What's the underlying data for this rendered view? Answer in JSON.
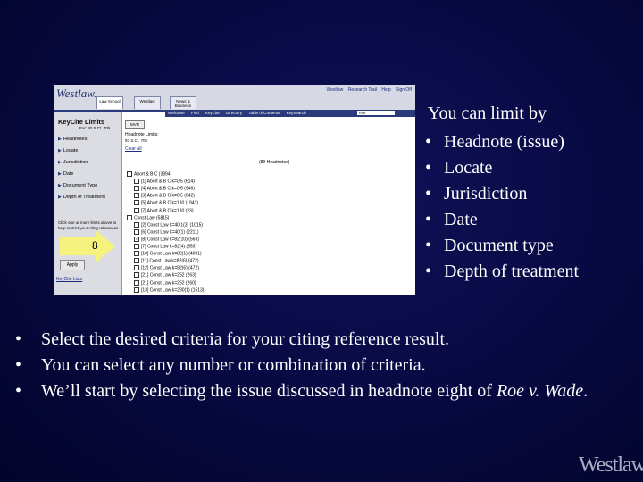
{
  "screenshot": {
    "logo": "Westlaw.",
    "tabs": [
      {
        "label": "Law School",
        "active": true
      },
      {
        "label": "Westlaw",
        "active": false
      },
      {
        "label": "News & Business",
        "active": false
      }
    ],
    "top_links": [
      "Westlaw",
      "Research Trail",
      "Help",
      "Sign Off"
    ],
    "nav_links": [
      "Welcome",
      "Find",
      "KeyCite",
      "Directory",
      "Table of Contents",
      "KeySearch"
    ],
    "search_value": "Roe",
    "sidebar": {
      "title": "KeyCite Limits",
      "citation": "For: 93 S.Ct. 705",
      "items": [
        "Headnotes",
        "Locate",
        "Jurisdiction",
        "Date",
        "Document Type",
        "Depth of Treatment"
      ],
      "note": "Click one or more limits above to help restrict your citing references.",
      "apply_label": "Apply",
      "keycite_link": "KeyCite Lists"
    },
    "main": {
      "mvr_label": "MVR",
      "headnote_title": "Headnote Limits:",
      "headnote_cite": "93 S.Ct. 705",
      "clear_label": "Clear All",
      "count": "(89 Headnotes)",
      "rows": [
        {
          "text": "Abort & B C (3894)",
          "checked": false,
          "indent": 0
        },
        {
          "text": "[1] Abort & B C k=0.5 (614)",
          "checked": false,
          "indent": 1
        },
        {
          "text": "[4] Abort & B C k=0.5 (946)",
          "checked": false,
          "indent": 1
        },
        {
          "text": "[3] Abort & B C k=0.5 (642)",
          "checked": false,
          "indent": 1
        },
        {
          "text": "[5] Abort & B C k=130 (1941)",
          "checked": false,
          "indent": 1
        },
        {
          "text": "[7] Abort & B C k=130 (23)",
          "checked": false,
          "indent": 1
        },
        {
          "text": "Const Law (5815)",
          "checked": false,
          "indent": 0
        },
        {
          "text": "[2] Const Law k=40.1(3) (1015)",
          "checked": false,
          "indent": 1
        },
        {
          "text": "[6] Const Law k=40(1) (2211)",
          "checked": false,
          "indent": 1
        },
        {
          "text": "[8] Const Law k=82(10) (563)",
          "checked": true,
          "indent": 1
        },
        {
          "text": "[7] Const Law k=82(4) (553)",
          "checked": false,
          "indent": 1
        },
        {
          "text": "[10] Const Law k=82(1) (4001)",
          "checked": false,
          "indent": 1
        },
        {
          "text": "[11] Const Law k=82(6) (472)",
          "checked": false,
          "indent": 1
        },
        {
          "text": "[12] Const Law k=82(6) (472)",
          "checked": false,
          "indent": 1
        },
        {
          "text": "[21] Const Law k=252 (263)",
          "checked": false,
          "indent": 1
        },
        {
          "text": "[21] Const Law k=252 (260)",
          "checked": false,
          "indent": 1
        },
        {
          "text": "[13] Const Law k=230(1) (1513)",
          "checked": false,
          "indent": 1
        }
      ]
    },
    "callout": "8"
  },
  "slide": {
    "right_title": "You can limit by",
    "right_items": [
      "Headnote  (issue)",
      "Locate",
      "Jurisdiction",
      "Date",
      "Document type",
      "Depth of treatment"
    ],
    "bottom_items": [
      "Select the desired criteria for your citing reference result.",
      "You can select any number or combination of criteria.",
      "We’ll start by selecting the issue discussed in headnote eight of "
    ],
    "case_name": "Roe v. Wade",
    "case_suffix": ".",
    "bullet": "•",
    "brand": "Westlaw"
  }
}
